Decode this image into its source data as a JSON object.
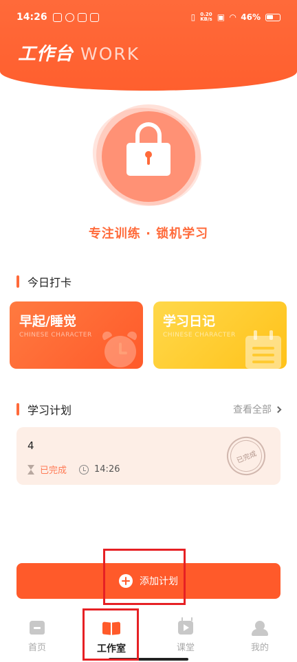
{
  "status_bar": {
    "time": "14:26",
    "net_speed_value": "0.20",
    "net_speed_unit": "KB/s",
    "battery": "46%"
  },
  "header": {
    "title_cn": "工作台",
    "title_en": "WORK"
  },
  "hero": {
    "slogan": "专注训练 · 锁机学习"
  },
  "checkin": {
    "section_title": "今日打卡",
    "cards": [
      {
        "title": "早起/睡觉",
        "subtitle": "CHINESE CHARACTER",
        "icon": "alarm-clock-icon",
        "color": "#ff6a3a"
      },
      {
        "title": "学习日记",
        "subtitle": "CHINESE CHARACTER",
        "icon": "notebook-icon",
        "color": "#ffc92a"
      }
    ]
  },
  "plans": {
    "section_title": "学习计划",
    "more_label": "查看全部",
    "items": [
      {
        "name": "4",
        "status": "已完成",
        "time": "14:26",
        "stamp": "已完成"
      }
    ]
  },
  "add_button": {
    "label": "添加计划"
  },
  "bottom_nav": {
    "items": [
      {
        "label": "首页",
        "icon": "home-icon",
        "active": false
      },
      {
        "label": "工作室",
        "icon": "book-icon",
        "active": true
      },
      {
        "label": "课堂",
        "icon": "tv-icon",
        "active": false
      },
      {
        "label": "我的",
        "icon": "user-icon",
        "active": false
      }
    ]
  },
  "colors": {
    "accent": "#ff5a2a",
    "highlight": "#e62024"
  }
}
